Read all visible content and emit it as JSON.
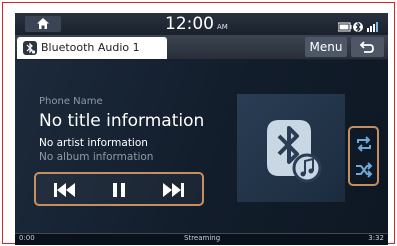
{
  "status_bar": {
    "time": "12:00",
    "ampm": "AM",
    "icons": [
      "home-icon",
      "battery-icon",
      "bluetooth-icon",
      "signal-icon"
    ]
  },
  "tab_bar": {
    "source_tab": "Bluetooth Audio 1",
    "menu_label": "Menu"
  },
  "track": {
    "device_name": "Phone Name",
    "title": "No title information",
    "artist": "No artist information",
    "album": "No album information"
  },
  "controls": {
    "icons": [
      "previous-track-icon",
      "pause-icon",
      "next-track-icon"
    ],
    "side_icons": [
      "repeat-icon",
      "shuffle-icon"
    ]
  },
  "bottom_bar": {
    "elapsed": "0:00",
    "status": "Streaming",
    "total": "3:32"
  },
  "colors": {
    "highlight": "#c58f64",
    "annotation_border": "#dd2222",
    "background": "#0c1522",
    "accent": "#6fa8d8"
  }
}
